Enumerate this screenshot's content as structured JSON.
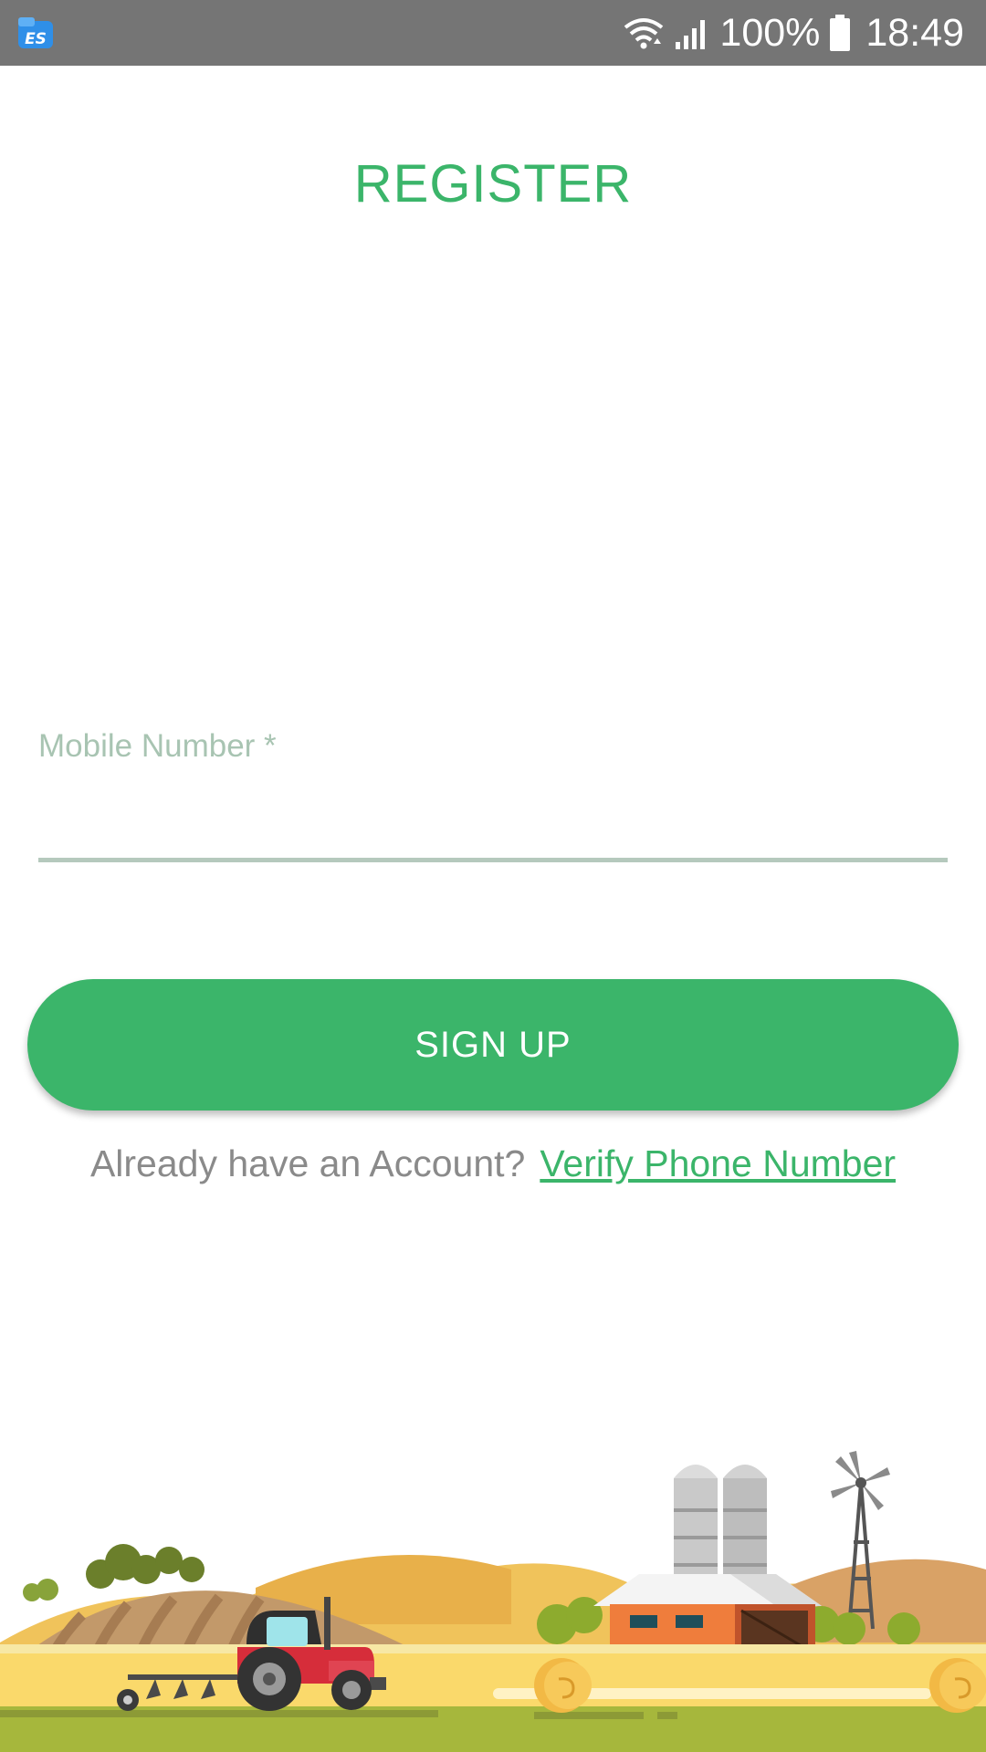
{
  "status_bar": {
    "app_icon": "es-file-explorer-icon",
    "icons": [
      "wifi-icon",
      "signal-icon",
      "battery-icon"
    ],
    "battery": "100%",
    "time": "18:49"
  },
  "title": "REGISTER",
  "form": {
    "mobile_label": "Mobile Number *",
    "mobile_value": ""
  },
  "signup_button": "SIGN UP",
  "account": {
    "prompt": "Already have an Account?",
    "link": "Verify Phone Number"
  },
  "colors": {
    "accent": "#3bb56a",
    "status_bar": "#757575",
    "label": "#a8c4b2",
    "muted_text": "#8a8a8a"
  },
  "illustration": "farm-landscape-with-tractor-barn-silos-windmill"
}
